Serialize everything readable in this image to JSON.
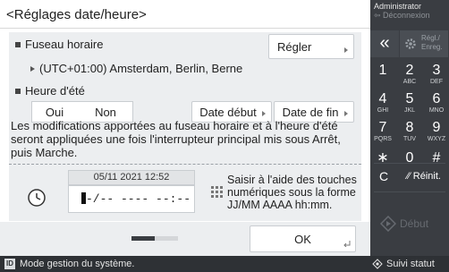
{
  "window": {
    "title": "<Réglages date/heure>"
  },
  "timezone": {
    "label": "Fuseau horaire",
    "button": "Régler",
    "value": "(UTC+01:00) Amsterdam, Berlin, Berne"
  },
  "dst": {
    "label": "Heure d'été",
    "on": "Oui",
    "off": "Non",
    "start_button": "Date début",
    "end_button": "Date de fin"
  },
  "info_text": "Les modifications apportées au fuseau horaire et à l'heure d'été seront appliquées une fois l'interrupteur principal mis sous Arrêt, puis Marche.",
  "datetime": {
    "current": "05/11 2021 12:52",
    "input_rest": "-/-- ---- --:--",
    "hint": "Saisir à l'aide des touches numériques sous la forme JJ/MM AAAA hh:mm."
  },
  "footer": {
    "ok": "OK",
    "progress": 0.5
  },
  "status_bar": {
    "message": "Mode gestion du système.",
    "id_badge": "ID",
    "right": "Suivi statut"
  },
  "keypad": {
    "admin_title": "Administrator",
    "admin_sub": "Déconnexion",
    "back": "«",
    "settings_line1": "Régl./",
    "settings_line2": "Enreg.",
    "keys": [
      {
        "n": "1",
        "l": ""
      },
      {
        "n": "2",
        "l": "ABC"
      },
      {
        "n": "3",
        "l": "DEF"
      },
      {
        "n": "4",
        "l": "GHI"
      },
      {
        "n": "5",
        "l": "JKL"
      },
      {
        "n": "6",
        "l": "MNO"
      },
      {
        "n": "7",
        "l": "PQRS"
      },
      {
        "n": "8",
        "l": "TUV"
      },
      {
        "n": "9",
        "l": "WXYZ"
      },
      {
        "n": "∗",
        "l": ""
      },
      {
        "n": "0",
        "l": ""
      },
      {
        "n": "#",
        "l": ""
      }
    ],
    "clear": "C",
    "reset": "Réinit.",
    "start": "Début"
  },
  "colors": {
    "panel_bg": "#eceef0",
    "keypad_bg": "#3a3d42",
    "status_bg": "#2e3135"
  }
}
